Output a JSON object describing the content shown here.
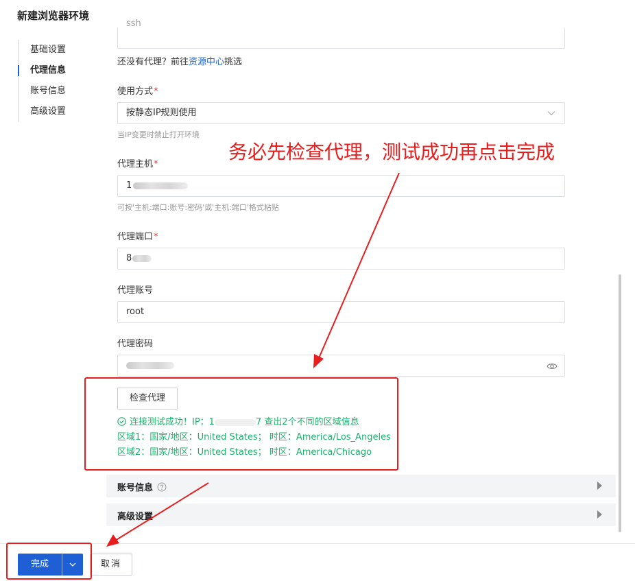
{
  "dialog": {
    "title": "新建浏览器环境"
  },
  "side_nav": {
    "items": [
      {
        "label": "基础设置"
      },
      {
        "label": "代理信息"
      },
      {
        "label": "账号信息"
      },
      {
        "label": "高级设置"
      }
    ],
    "active": "代理信息"
  },
  "proxy": {
    "type_value": "ssh",
    "no_proxy_prefix": "还没有代理？前往",
    "resource_link": "资源中心",
    "no_proxy_suffix": "挑选",
    "usage_label": "使用方式",
    "usage_value": "按静态IP规则使用",
    "usage_hint": "当IP变更时禁止打开环境",
    "host_label": "代理主机",
    "host_value_visible": "1",
    "host_hint": "可按'主机:端口:账号:密码'或'主机:端口'格式粘贴",
    "port_label": "代理端口",
    "port_value_visible": "8",
    "account_label": "代理账号",
    "account_value": "root",
    "password_label": "代理密码",
    "check_button": "检查代理",
    "result_line1_prefix": "连接测试成功！IP：1",
    "result_line1_suffix": "7 查出2个不同的区域信息",
    "result_line2": "区域1：国家/地区：United States； 时区：America/Los_Angeles",
    "result_line3": "区域2：国家/地区：United States； 时区：America/Chicago"
  },
  "collapses": {
    "account": "账号信息",
    "advanced": "高级设置"
  },
  "footer": {
    "done": "完成",
    "cancel": "取消"
  },
  "annotation": {
    "text": "务必先检查代理，测试成功再点击完成"
  },
  "colors": {
    "primary": "#1e5fd6",
    "success": "#19b36b",
    "required": "#e8382b",
    "annotation_red": "#e81e1e"
  },
  "icons": [
    "chevron-down-icon",
    "eye-icon",
    "check-circle-icon",
    "question-circle-icon",
    "caret-right-icon"
  ]
}
